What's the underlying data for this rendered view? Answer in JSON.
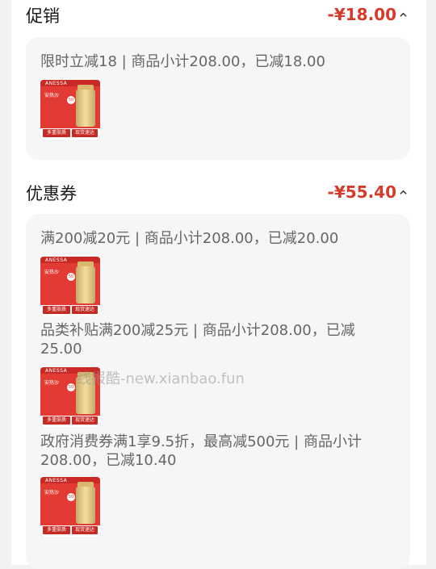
{
  "sections": [
    {
      "title": "促销",
      "amount": "-¥18.00",
      "items": [
        {
          "text": "限时立减18 | 商品小计208.00，已减18.00"
        }
      ]
    },
    {
      "title": "优惠券",
      "amount": "-¥55.40",
      "items": [
        {
          "text": "满200减20元 | 商品小计208.00，已减20.00"
        },
        {
          "text": "品类补贴满200减25元 | 商品小计208.00，已减25.00"
        },
        {
          "text": "政府消费券满1享9.5折，最高减500元 | 商品小计208.00，已减10.40"
        }
      ]
    }
  ],
  "product_thumb": {
    "brand": "ANESSA",
    "name": "安热沙",
    "tag_left": "多重肤质",
    "tag_right": "现货速达"
  },
  "watermark": "线报酷-new.xianbao.fun",
  "colors": {
    "accent": "#d63b2a",
    "panel": "#f6f6f6",
    "background": "#f2f2f2"
  },
  "icons": {
    "collapse": "chevron-up-icon"
  }
}
